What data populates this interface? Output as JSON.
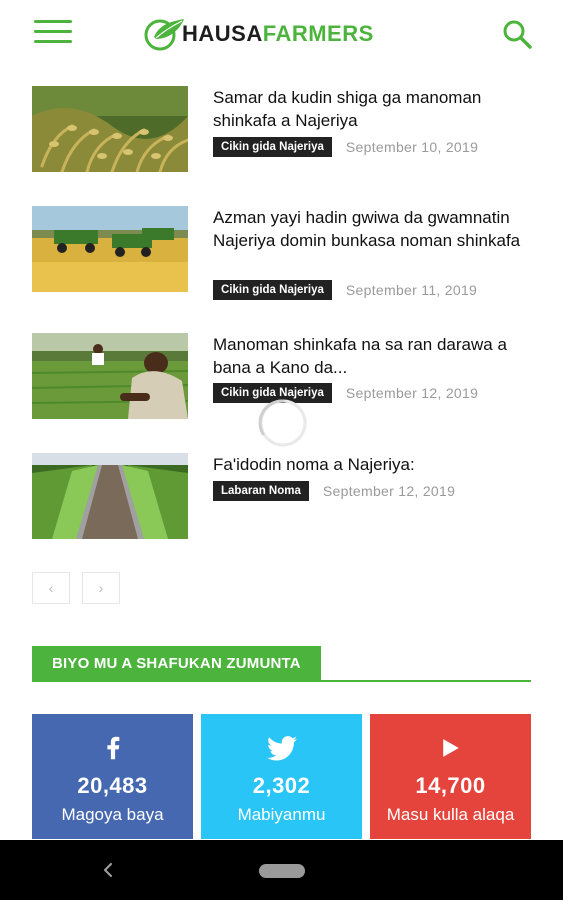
{
  "header": {
    "logo_hausa": "HAUSA",
    "logo_farmers": "FARMERS",
    "brand_color": "#4cb43c"
  },
  "articles": [
    {
      "title": "Samar da kudin shiga ga manoman shinkafa a Najeriya",
      "category": "Cikin gida Najeriya",
      "date": "September 10, 2019",
      "image": "rice-paddy-closeup"
    },
    {
      "title": "Azman yayi hadin gwiwa da gwamnatin Najeriya domin bunkasa noman shinkafa",
      "category": "Cikin gida Najeriya",
      "date": "September 11, 2019",
      "image": "combine-harvester-field"
    },
    {
      "title": "Manoman shinkafa na sa ran darawa a bana a Kano da...",
      "category": "Cikin gida Najeriya",
      "date": "September 12, 2019",
      "image": "farmer-in-field"
    },
    {
      "title": "Fa'idodin noma a Najeriya:",
      "category": "Labaran Noma",
      "date": "September 12, 2019",
      "image": "crop-rows-mulch"
    }
  ],
  "pagination": {
    "prev": "‹",
    "next": "›"
  },
  "section": {
    "heading": "BIYO MU A SHAFUKAN ZUMUNTA"
  },
  "social": [
    {
      "icon": "facebook-icon",
      "count": "20,483",
      "label": "Magoya baya",
      "color": "#4668b0"
    },
    {
      "icon": "twitter-icon",
      "count": "2,302",
      "label": "Mabiyanmu",
      "color": "#29c5f6"
    },
    {
      "icon": "youtube-icon",
      "count": "14,700",
      "label": "Masu kulla alaqa",
      "color": "#e5443d"
    }
  ],
  "navbar": {
    "back": "‹"
  }
}
